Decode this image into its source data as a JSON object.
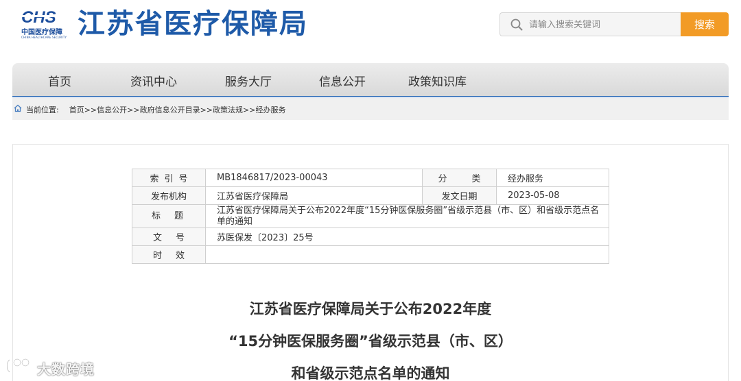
{
  "header": {
    "logo_mark": "CHS",
    "logo_cn": "中国医疗保障",
    "logo_en": "CHINA HEALTHCARE SECURITY",
    "site_title": "江苏省医疗保障局",
    "search_placeholder": "请输入搜索关键词",
    "search_button": "搜索",
    "colors": {
      "brand_blue": "#1e5aa8",
      "search_orange": "#f29b26"
    }
  },
  "nav": {
    "items": [
      {
        "label": "首页"
      },
      {
        "label": "资讯中心"
      },
      {
        "label": "服务大厅"
      },
      {
        "label": "信息公开"
      },
      {
        "label": "政策知识库"
      }
    ]
  },
  "breadcrumb": {
    "icon": "home-icon",
    "prefix": "当前位置:",
    "path": "首页>>信息公开>>政府信息公开目录>>政策法规>>经办服务"
  },
  "meta": {
    "index_label": "索引号",
    "index_value": "MB1846817/2023-00043",
    "category_label": "分类",
    "category_value": "经办服务",
    "publisher_label": "发布机构",
    "publisher_value": "江苏省医疗保障局",
    "date_label": "发文日期",
    "date_value": "2023-05-08",
    "title_label": "标题",
    "title_value": "江苏省医疗保障局关于公布2022年度“15分钟医保服务圈”省级示范县（市、区）和省级示范点名单的通知",
    "docno_label": "文号",
    "docno_value": "苏医保发〔2023〕25号",
    "validity_label": "时效",
    "validity_value": ""
  },
  "article": {
    "title_line1": "江苏省医疗保障局关于公布2022年度",
    "title_line2": "“15分钟医保服务圈”省级示范县（市、区）",
    "title_line3": "和省级示范点名单的通知"
  },
  "watermark": {
    "text": "大数跨境"
  }
}
